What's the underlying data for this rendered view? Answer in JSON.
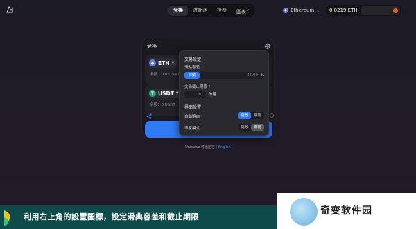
{
  "nav": {
    "tabs": [
      {
        "label": "兌換",
        "active": true
      },
      {
        "label": "流動池",
        "active": false
      },
      {
        "label": "投票",
        "active": false
      },
      {
        "label": "圖表",
        "active": false
      }
    ],
    "chart_tab_suffix": "↗"
  },
  "network": {
    "label": "Ethereum",
    "icon": "ethereum-icon"
  },
  "wallet": {
    "balance": "0.0219 ETH",
    "avatar_color": "#e0602a"
  },
  "swap": {
    "title": "兌換",
    "from": {
      "token": "ETH",
      "balance": "余額：0.02194 ET"
    },
    "to": {
      "token": "USDT",
      "balance": "余額：0 USDT"
    }
  },
  "settings": {
    "heading_trade": "交易設定",
    "slippage_label": "滑點容差",
    "auto_label": "自動",
    "slippage_placeholder": "25.00",
    "slippage_unit": "%",
    "deadline_label": "交易截止期限",
    "deadline_placeholder": "30",
    "deadline_unit": "分鐘",
    "heading_ui": "界面設置",
    "auto_route_label": "自動路由",
    "expert_mode_label": "專家模式",
    "on_label": "開啟",
    "off_label": "關閉",
    "question_mark": "?"
  },
  "footer": {
    "brand": "Uniswap",
    "lang_current": "可還語言",
    "separator": "|",
    "lang_link": "English"
  },
  "banner": {
    "text": "利用右上角的設置圖標，設定滑典容差和截止期限"
  },
  "watermark": {
    "text": "奇变软件园"
  },
  "colors": {
    "accent": "#2f7bf5",
    "eth": "#627eea",
    "usdt": "#26a17b",
    "banner": "#0f4a4a"
  }
}
